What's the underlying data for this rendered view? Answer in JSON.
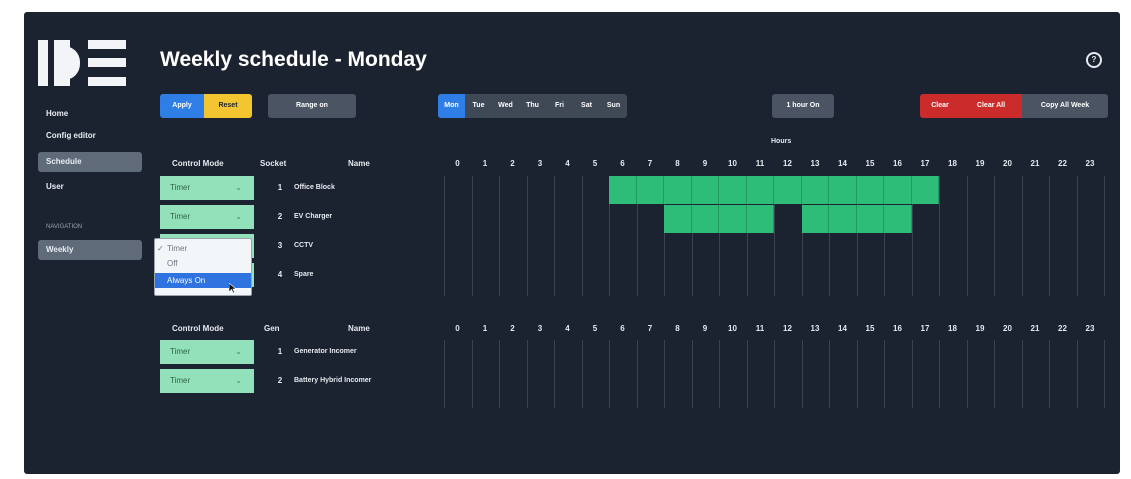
{
  "page": {
    "title": "Weekly schedule - Monday"
  },
  "sidebar": {
    "items": [
      {
        "label": "Home"
      },
      {
        "label": "Config editor"
      },
      {
        "label": "Schedule"
      },
      {
        "label": "User"
      }
    ],
    "section_label": "NAVIGATION",
    "sub_items": [
      {
        "label": "Weekly"
      }
    ]
  },
  "toolbar": {
    "apply": "Apply",
    "reset": "Reset",
    "range": "Range on",
    "days": [
      "Mon",
      "Tue",
      "Wed",
      "Thu",
      "Fri",
      "Sat",
      "Sun"
    ],
    "active_day": "Mon",
    "hour_on": "1 hour On",
    "clear": "Clear",
    "clear_all": "Clear All",
    "copy_all_week": "Copy All Week"
  },
  "hours_header": "Hours",
  "hours": [
    0,
    1,
    2,
    3,
    4,
    5,
    6,
    7,
    8,
    9,
    10,
    11,
    12,
    13,
    14,
    15,
    16,
    17,
    18,
    19,
    20,
    21,
    22,
    23
  ],
  "sockets_table": {
    "headers": {
      "mode": "Control Mode",
      "id": "Socket",
      "name": "Name"
    },
    "rows": [
      {
        "mode": "Timer",
        "id": "1",
        "name": "Office Block",
        "on_hours": [
          6,
          7,
          8,
          9,
          10,
          11,
          12,
          13,
          14,
          15,
          16,
          17
        ]
      },
      {
        "mode": "Timer",
        "id": "2",
        "name": "EV Charger",
        "on_hours": [
          8,
          9,
          10,
          11,
          13,
          14,
          15,
          16
        ]
      },
      {
        "mode": "Timer",
        "id": "3",
        "name": "CCTV",
        "on_hours": []
      },
      {
        "mode": "",
        "id": "4",
        "name": "Spare",
        "on_hours": []
      }
    ]
  },
  "gens_table": {
    "headers": {
      "mode": "Control Mode",
      "id": "Gen",
      "name": "Name"
    },
    "rows": [
      {
        "mode": "Timer",
        "id": "1",
        "name": "Generator Incomer",
        "on_hours": []
      },
      {
        "mode": "Timer",
        "id": "2",
        "name": "Battery Hybrid Incomer",
        "on_hours": []
      }
    ]
  },
  "dropdown": {
    "options": [
      "Timer",
      "Off",
      "Always On"
    ],
    "checked": "Timer",
    "highlighted": "Always On"
  },
  "colors": {
    "background": "#1b2230",
    "accent": "#2e7ee6",
    "on_cell": "#2ebd78",
    "select_bg": "#93e1ba",
    "danger": "#cc2b2b",
    "warning": "#f2c531"
  }
}
